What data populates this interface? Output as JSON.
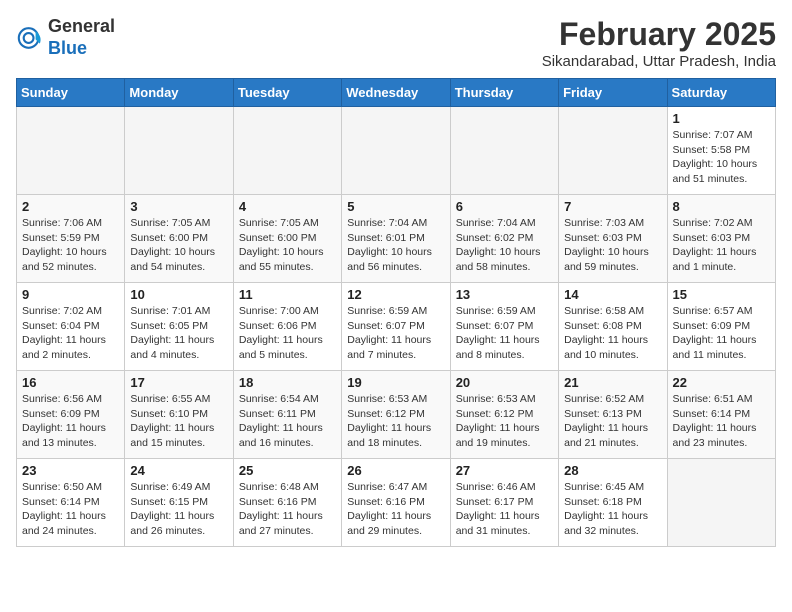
{
  "header": {
    "logo_line1": "General",
    "logo_line2": "Blue",
    "month_title": "February 2025",
    "location": "Sikandarabad, Uttar Pradesh, India"
  },
  "days_of_week": [
    "Sunday",
    "Monday",
    "Tuesday",
    "Wednesday",
    "Thursday",
    "Friday",
    "Saturday"
  ],
  "weeks": [
    [
      {
        "day": "",
        "empty": true
      },
      {
        "day": "",
        "empty": true
      },
      {
        "day": "",
        "empty": true
      },
      {
        "day": "",
        "empty": true
      },
      {
        "day": "",
        "empty": true
      },
      {
        "day": "",
        "empty": true
      },
      {
        "day": "1",
        "sunrise": "Sunrise: 7:07 AM",
        "sunset": "Sunset: 5:58 PM",
        "daylight": "Daylight: 10 hours and 51 minutes."
      }
    ],
    [
      {
        "day": "2",
        "sunrise": "Sunrise: 7:06 AM",
        "sunset": "Sunset: 5:59 PM",
        "daylight": "Daylight: 10 hours and 52 minutes."
      },
      {
        "day": "3",
        "sunrise": "Sunrise: 7:05 AM",
        "sunset": "Sunset: 6:00 PM",
        "daylight": "Daylight: 10 hours and 54 minutes."
      },
      {
        "day": "4",
        "sunrise": "Sunrise: 7:05 AM",
        "sunset": "Sunset: 6:00 PM",
        "daylight": "Daylight: 10 hours and 55 minutes."
      },
      {
        "day": "5",
        "sunrise": "Sunrise: 7:04 AM",
        "sunset": "Sunset: 6:01 PM",
        "daylight": "Daylight: 10 hours and 56 minutes."
      },
      {
        "day": "6",
        "sunrise": "Sunrise: 7:04 AM",
        "sunset": "Sunset: 6:02 PM",
        "daylight": "Daylight: 10 hours and 58 minutes."
      },
      {
        "day": "7",
        "sunrise": "Sunrise: 7:03 AM",
        "sunset": "Sunset: 6:03 PM",
        "daylight": "Daylight: 10 hours and 59 minutes."
      },
      {
        "day": "8",
        "sunrise": "Sunrise: 7:02 AM",
        "sunset": "Sunset: 6:03 PM",
        "daylight": "Daylight: 11 hours and 1 minute."
      }
    ],
    [
      {
        "day": "9",
        "sunrise": "Sunrise: 7:02 AM",
        "sunset": "Sunset: 6:04 PM",
        "daylight": "Daylight: 11 hours and 2 minutes."
      },
      {
        "day": "10",
        "sunrise": "Sunrise: 7:01 AM",
        "sunset": "Sunset: 6:05 PM",
        "daylight": "Daylight: 11 hours and 4 minutes."
      },
      {
        "day": "11",
        "sunrise": "Sunrise: 7:00 AM",
        "sunset": "Sunset: 6:06 PM",
        "daylight": "Daylight: 11 hours and 5 minutes."
      },
      {
        "day": "12",
        "sunrise": "Sunrise: 6:59 AM",
        "sunset": "Sunset: 6:07 PM",
        "daylight": "Daylight: 11 hours and 7 minutes."
      },
      {
        "day": "13",
        "sunrise": "Sunrise: 6:59 AM",
        "sunset": "Sunset: 6:07 PM",
        "daylight": "Daylight: 11 hours and 8 minutes."
      },
      {
        "day": "14",
        "sunrise": "Sunrise: 6:58 AM",
        "sunset": "Sunset: 6:08 PM",
        "daylight": "Daylight: 11 hours and 10 minutes."
      },
      {
        "day": "15",
        "sunrise": "Sunrise: 6:57 AM",
        "sunset": "Sunset: 6:09 PM",
        "daylight": "Daylight: 11 hours and 11 minutes."
      }
    ],
    [
      {
        "day": "16",
        "sunrise": "Sunrise: 6:56 AM",
        "sunset": "Sunset: 6:09 PM",
        "daylight": "Daylight: 11 hours and 13 minutes."
      },
      {
        "day": "17",
        "sunrise": "Sunrise: 6:55 AM",
        "sunset": "Sunset: 6:10 PM",
        "daylight": "Daylight: 11 hours and 15 minutes."
      },
      {
        "day": "18",
        "sunrise": "Sunrise: 6:54 AM",
        "sunset": "Sunset: 6:11 PM",
        "daylight": "Daylight: 11 hours and 16 minutes."
      },
      {
        "day": "19",
        "sunrise": "Sunrise: 6:53 AM",
        "sunset": "Sunset: 6:12 PM",
        "daylight": "Daylight: 11 hours and 18 minutes."
      },
      {
        "day": "20",
        "sunrise": "Sunrise: 6:53 AM",
        "sunset": "Sunset: 6:12 PM",
        "daylight": "Daylight: 11 hours and 19 minutes."
      },
      {
        "day": "21",
        "sunrise": "Sunrise: 6:52 AM",
        "sunset": "Sunset: 6:13 PM",
        "daylight": "Daylight: 11 hours and 21 minutes."
      },
      {
        "day": "22",
        "sunrise": "Sunrise: 6:51 AM",
        "sunset": "Sunset: 6:14 PM",
        "daylight": "Daylight: 11 hours and 23 minutes."
      }
    ],
    [
      {
        "day": "23",
        "sunrise": "Sunrise: 6:50 AM",
        "sunset": "Sunset: 6:14 PM",
        "daylight": "Daylight: 11 hours and 24 minutes."
      },
      {
        "day": "24",
        "sunrise": "Sunrise: 6:49 AM",
        "sunset": "Sunset: 6:15 PM",
        "daylight": "Daylight: 11 hours and 26 minutes."
      },
      {
        "day": "25",
        "sunrise": "Sunrise: 6:48 AM",
        "sunset": "Sunset: 6:16 PM",
        "daylight": "Daylight: 11 hours and 27 minutes."
      },
      {
        "day": "26",
        "sunrise": "Sunrise: 6:47 AM",
        "sunset": "Sunset: 6:16 PM",
        "daylight": "Daylight: 11 hours and 29 minutes."
      },
      {
        "day": "27",
        "sunrise": "Sunrise: 6:46 AM",
        "sunset": "Sunset: 6:17 PM",
        "daylight": "Daylight: 11 hours and 31 minutes."
      },
      {
        "day": "28",
        "sunrise": "Sunrise: 6:45 AM",
        "sunset": "Sunset: 6:18 PM",
        "daylight": "Daylight: 11 hours and 32 minutes."
      },
      {
        "day": "",
        "empty": true
      }
    ]
  ]
}
